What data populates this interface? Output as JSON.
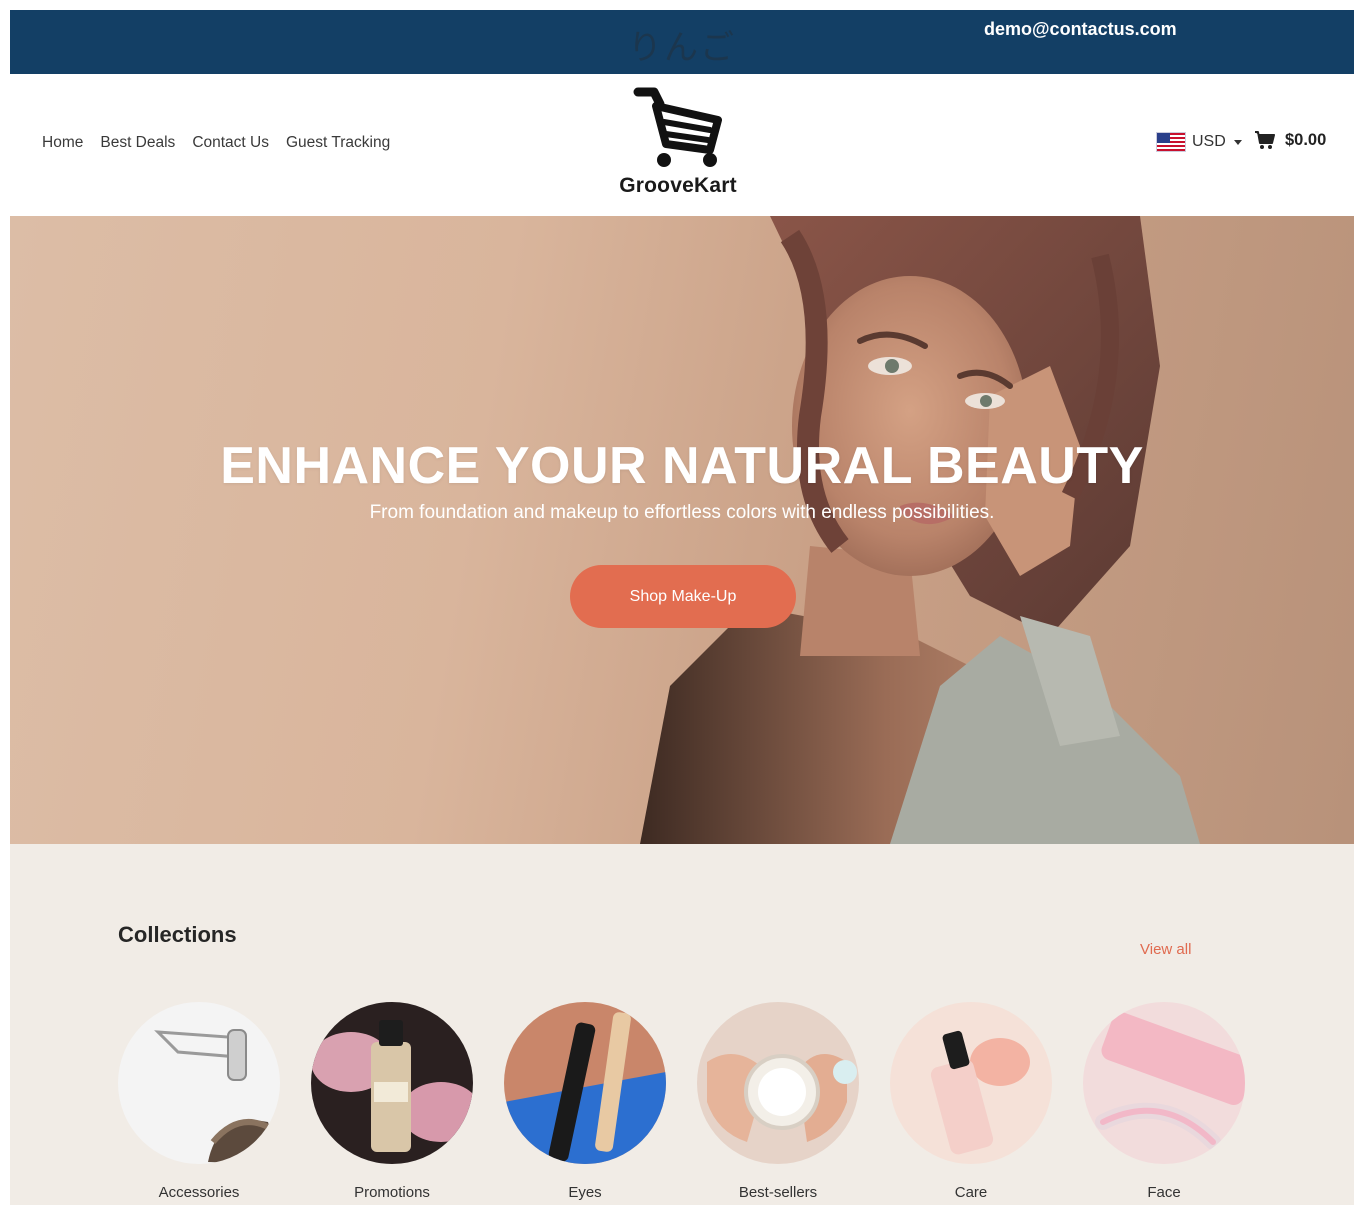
{
  "topbar": {
    "jp_text": "りんご",
    "email": "demo@contactus.com"
  },
  "nav": {
    "items": [
      {
        "label": "Home"
      },
      {
        "label": "Best Deals"
      },
      {
        "label": "Contact Us"
      },
      {
        "label": "Guest Tracking"
      }
    ]
  },
  "logo": {
    "name": "GrooveKart",
    "icon": "shopping-cart-icon"
  },
  "currency": {
    "code": "USD",
    "flag": "us-flag-icon"
  },
  "cart": {
    "total": "$0.00",
    "icon": "cart-icon"
  },
  "hero": {
    "title": "ENHANCE YOUR NATURAL BEAUTY",
    "subtitle": "From foundation and makeup to effortless colors with endless possibilities.",
    "button_label": "Shop Make-Up"
  },
  "collections": {
    "title": "Collections",
    "view_all": "View all",
    "items": [
      {
        "label": "Accessories"
      },
      {
        "label": "Promotions"
      },
      {
        "label": "Eyes"
      },
      {
        "label": "Best-sellers"
      },
      {
        "label": "Care"
      },
      {
        "label": "Face"
      }
    ]
  },
  "colors": {
    "topbar_bg": "#133f65",
    "accent": "#e26d50",
    "collections_bg": "#f1ece6"
  }
}
